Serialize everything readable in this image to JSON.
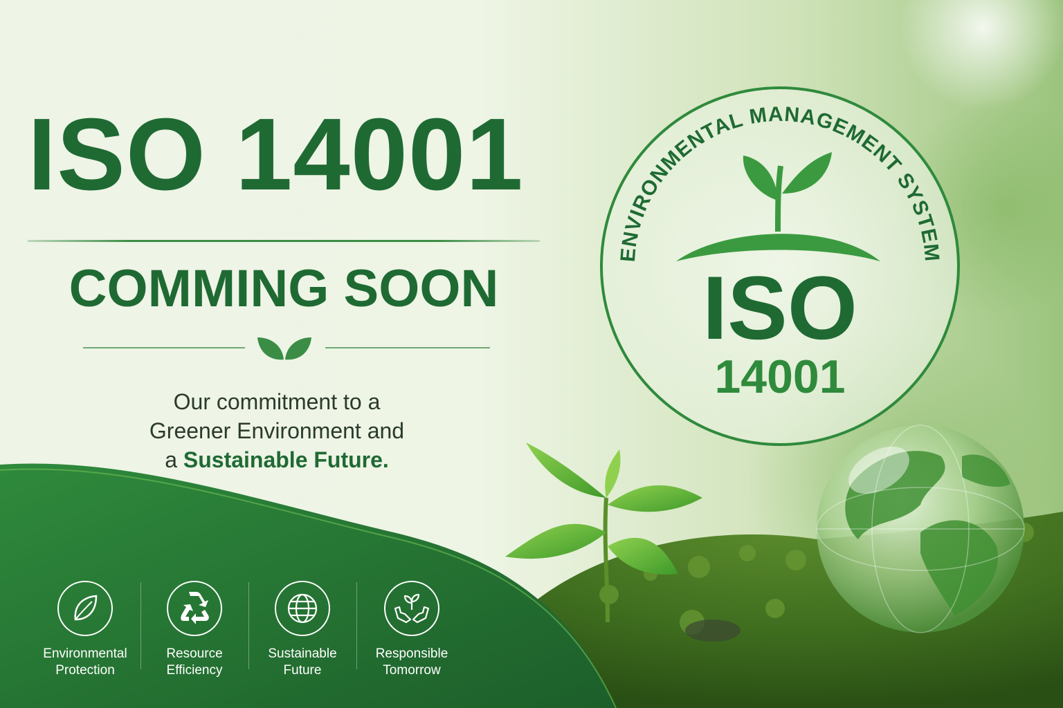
{
  "headline": "ISO 14001",
  "subheadline": "COMMING SOON",
  "tagline": {
    "line1": "Our commitment to a",
    "line2": "Greener Environment and",
    "line3_prefix": "a ",
    "line3_highlight": "Sustainable Future."
  },
  "seal": {
    "ring_text": "ENVIRONMENTAL MANAGEMENT SYSTEM",
    "title": "ISO",
    "number": "14001"
  },
  "features": [
    {
      "line1": "Environmental",
      "line2": "Protection",
      "icon": "leaf-icon"
    },
    {
      "line1": "Resource",
      "line2": "Efficiency",
      "icon": "recycle-icon"
    },
    {
      "line1": "Sustainable",
      "line2": "Future",
      "icon": "globe-icon"
    },
    {
      "line1": "Responsible",
      "line2": "Tomorrow",
      "icon": "hands-plant-icon"
    }
  ],
  "colors": {
    "primary_green": "#1f6a33",
    "accent_green": "#2f8a3c",
    "wave_green": "#2a7a36",
    "background_light": "#eef5e6"
  }
}
